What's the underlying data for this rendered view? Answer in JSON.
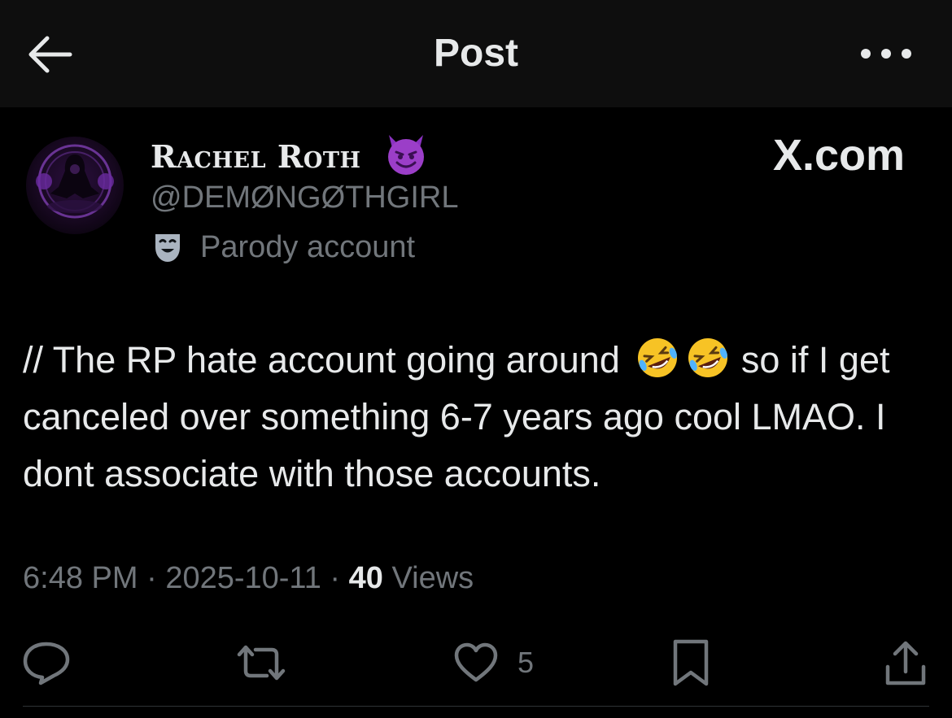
{
  "header": {
    "title": "Post"
  },
  "author": {
    "display_name": "Rachel Roth",
    "handle": "@DEMØNGØTHGIRL",
    "label": "Parody account"
  },
  "watermark": "X.com",
  "post": {
    "text_part1": "// The RP hate account going around",
    "text_part2": " so if I get canceled over something 6-7 years ago cool LMAO. I dont associate with those accounts."
  },
  "meta": {
    "time": "6:48 PM",
    "sep1": " · ",
    "date": "2025-10-11",
    "sep2": " · ",
    "views_count": "40",
    "views_label": " Views"
  },
  "actions": {
    "reply_icon": "reply-icon",
    "repost_icon": "repost-icon",
    "like_icon": "heart-icon",
    "like_count": "5",
    "bookmark_icon": "bookmark-icon",
    "share_icon": "share-icon"
  },
  "colors": {
    "background": "#000000",
    "topbar": "#0e0e0e",
    "primary_text": "#e7e9ea",
    "secondary_text": "#71767b",
    "emoji_purple": "#9b3ec8",
    "emoji_yellow": "#f7c325"
  }
}
